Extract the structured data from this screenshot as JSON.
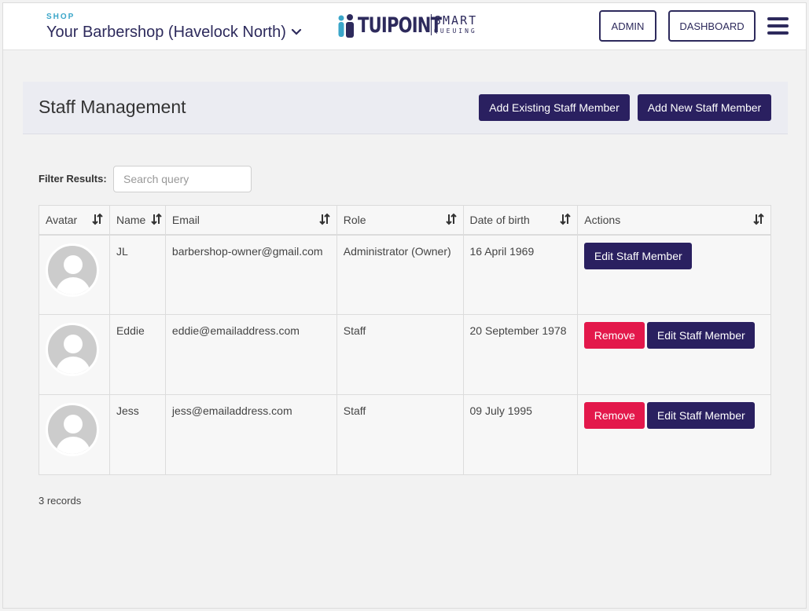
{
  "header": {
    "shop_label": "SHOP",
    "shop_name": "Your Barbershop (Havelock North)",
    "logo_main": "TUIPOINT",
    "logo_smart": "SMART",
    "logo_queuing": "QUEUING",
    "admin_label": "ADMIN",
    "dashboard_label": "DASHBOARD",
    "brand_color": "#2d2a5c"
  },
  "page": {
    "title": "Staff Management",
    "add_existing_label": "Add Existing Staff Member",
    "add_new_label": "Add New Staff Member"
  },
  "filter": {
    "label": "Filter Results:",
    "placeholder": "Search query",
    "value": ""
  },
  "table": {
    "columns": [
      "Avatar",
      "Name",
      "Email",
      "Role",
      "Date of birth",
      "Actions"
    ],
    "rows": [
      {
        "name": "JL",
        "email": "barbershop-owner@gmail.com",
        "role": "Administrator (Owner)",
        "dob": "16 April 1969",
        "remove_label": "",
        "edit_label": "Edit Staff Member"
      },
      {
        "name": "Eddie",
        "email": "eddie@emailaddress.com",
        "role": "Staff",
        "dob": "20 September 1978",
        "remove_label": "Remove",
        "edit_label": "Edit Staff Member"
      },
      {
        "name": "Jess",
        "email": "jess@emailaddress.com",
        "role": "Staff",
        "dob": "09 July 1995",
        "remove_label": "Remove",
        "edit_label": "Edit Staff Member"
      }
    ]
  },
  "footer": {
    "records": "3 records"
  },
  "colors": {
    "primary": "#2a2060",
    "danger": "#e3184b",
    "accent": "#3aa6c9"
  }
}
